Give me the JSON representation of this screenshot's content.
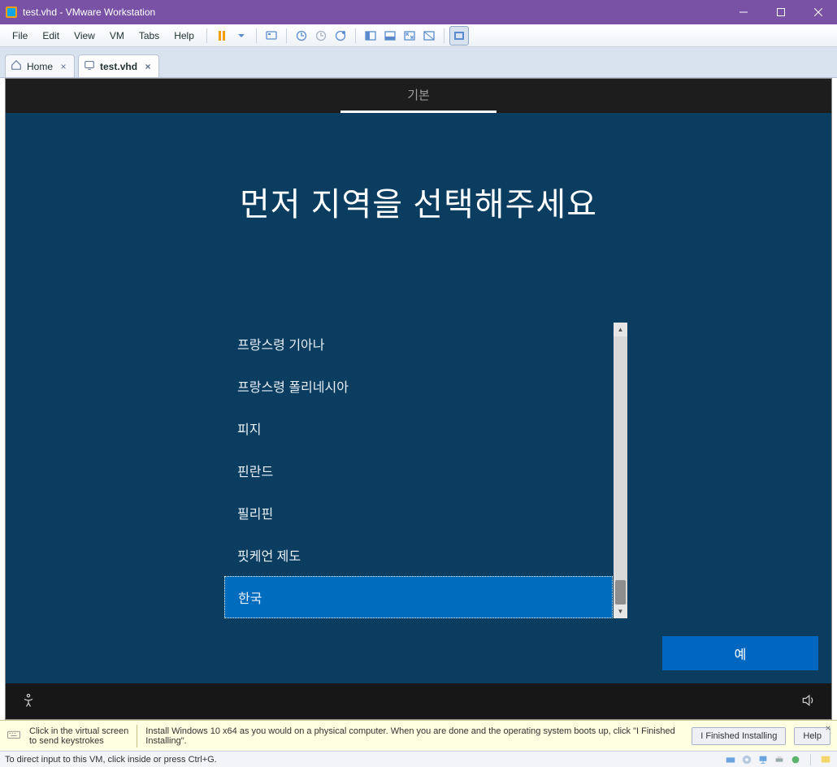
{
  "window": {
    "title": "test.vhd - VMware Workstation"
  },
  "menu": {
    "file": "File",
    "edit": "Edit",
    "view": "View",
    "vm": "VM",
    "tabs": "Tabs",
    "help": "Help"
  },
  "tabs": [
    {
      "label": "Home"
    },
    {
      "label": "test.vhd"
    }
  ],
  "oobe": {
    "tab_label": "기본",
    "heading": "먼저 지역을 선택해주세요",
    "regions": [
      "프랑스령 기아나",
      "프랑스령 폴리네시아",
      "피지",
      "핀란드",
      "필리핀",
      "핏케언 제도",
      "한국"
    ],
    "selected_index": 6,
    "yes_button": "예"
  },
  "info_bar": {
    "hint_line1": "Click in the virtual screen",
    "hint_line2": "to send keystrokes",
    "message": "Install Windows 10 x64 as you would on a physical computer. When you are done and the operating system boots up, click \"I Finished Installing\".",
    "finished_button": "I Finished Installing",
    "help_button": "Help"
  },
  "status_bar": {
    "message": "To direct input to this VM, click inside or press Ctrl+G."
  }
}
